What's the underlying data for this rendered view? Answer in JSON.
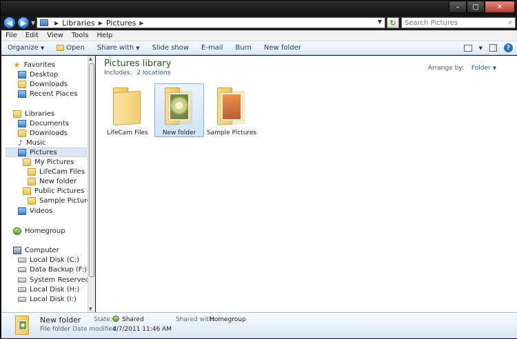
{
  "address": {
    "segments": [
      "Libraries",
      "Pictures"
    ]
  },
  "search": {
    "placeholder": "Search Pictures"
  },
  "menu": [
    "File",
    "Edit",
    "View",
    "Tools",
    "Help"
  ],
  "commands": {
    "organize": "Organize",
    "open": "Open",
    "share_with": "Share with",
    "slide_show": "Slide show",
    "email": "E-mail",
    "burn": "Burn",
    "new_folder": "New folder"
  },
  "nav": {
    "favorites": "Favorites",
    "desktop": "Desktop",
    "downloads": "Downloads",
    "recent_places": "Recent Places",
    "libraries": "Libraries",
    "documents": "Documents",
    "lib_downloads": "Downloads",
    "music": "Music",
    "pictures": "Pictures",
    "my_pictures": "My Pictures",
    "lifecam_files": "LifeCam Files",
    "new_folder": "New folder",
    "public_pictures": "Public Pictures",
    "sample_pictures": "Sample Pictures",
    "videos": "Videos",
    "homegroup": "Homegroup",
    "computer": "Computer",
    "disk_c": "Local Disk (C:)",
    "disk_f": "Data Backup (F:)",
    "disk_g": "System Reserved (G:)",
    "disk_h": "Local Disk (H:)",
    "disk_i": "Local Disk (I:)"
  },
  "library": {
    "title": "Pictures library",
    "includes_label": "Includes:",
    "includes_link": "2 locations",
    "arrange_label": "Arrange by:",
    "arrange_value": "Folder"
  },
  "folders": [
    {
      "name": "LifeCam Files"
    },
    {
      "name": "New folder"
    },
    {
      "name": "Sample Pictures"
    }
  ],
  "details": {
    "name": "New folder",
    "type": "File folder",
    "state_label": "State:",
    "state_value": "Shared",
    "shared_label": "Shared with:",
    "shared_value": "Homegroup",
    "modified_label": "Date modified:",
    "modified_value": "4/7/2011 11:46 AM"
  },
  "colors": {
    "library_title": "#1e5d1e",
    "link": "#1e5fb4",
    "selection": "#cfe4fa"
  }
}
